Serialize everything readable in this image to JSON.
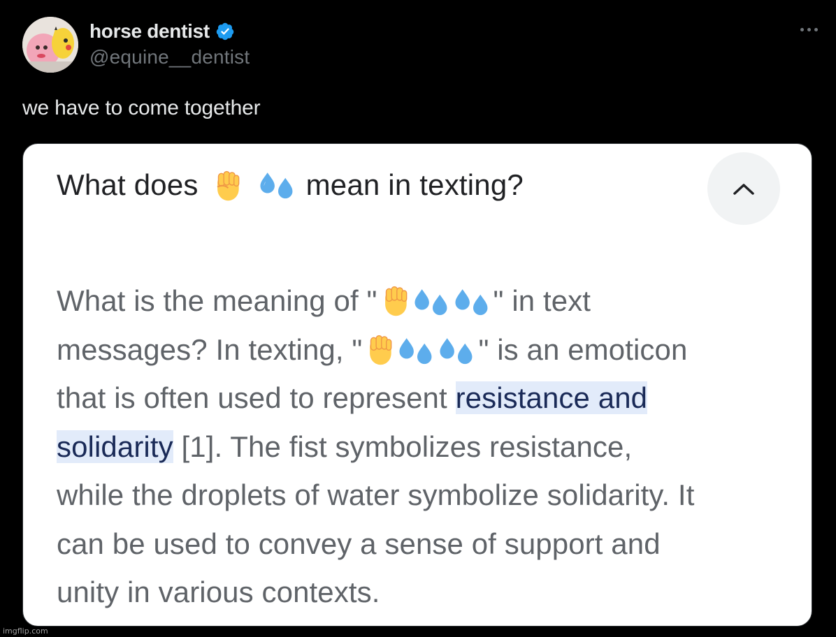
{
  "post": {
    "author": {
      "display_name": "horse dentist",
      "handle": "@equine__dentist",
      "verified": true,
      "verified_color": "#1d9bf0"
    },
    "text": "we have to come together",
    "more_icon": "more-horizontal-icon"
  },
  "screenshot_card": {
    "question_before": "What does",
    "question_emojis": [
      "raised-fist-emoji",
      "sweat-droplets-emoji"
    ],
    "question_after": "mean in texting?",
    "collapse_icon": "chevron-up-icon",
    "answer": {
      "l1_a": "What is the meaning of \"",
      "l1_b": "\" in text",
      "l2_a": "messages? In texting, \"",
      "l2_b": "\" is an emoticon",
      "l3_a": "that is often used to represent ",
      "l3_hl": "resistance and",
      "l4_hl": "solidarity",
      "l4_b": " [1]. The fist symbolizes resistance,",
      "l5": "while the droplets of water symbolize solidarity. It",
      "l6": "can be used to convey a sense of support and",
      "l7": "unity in various contexts."
    },
    "highlight_color": "#e2ebfa"
  },
  "watermark": "imgflip.com"
}
